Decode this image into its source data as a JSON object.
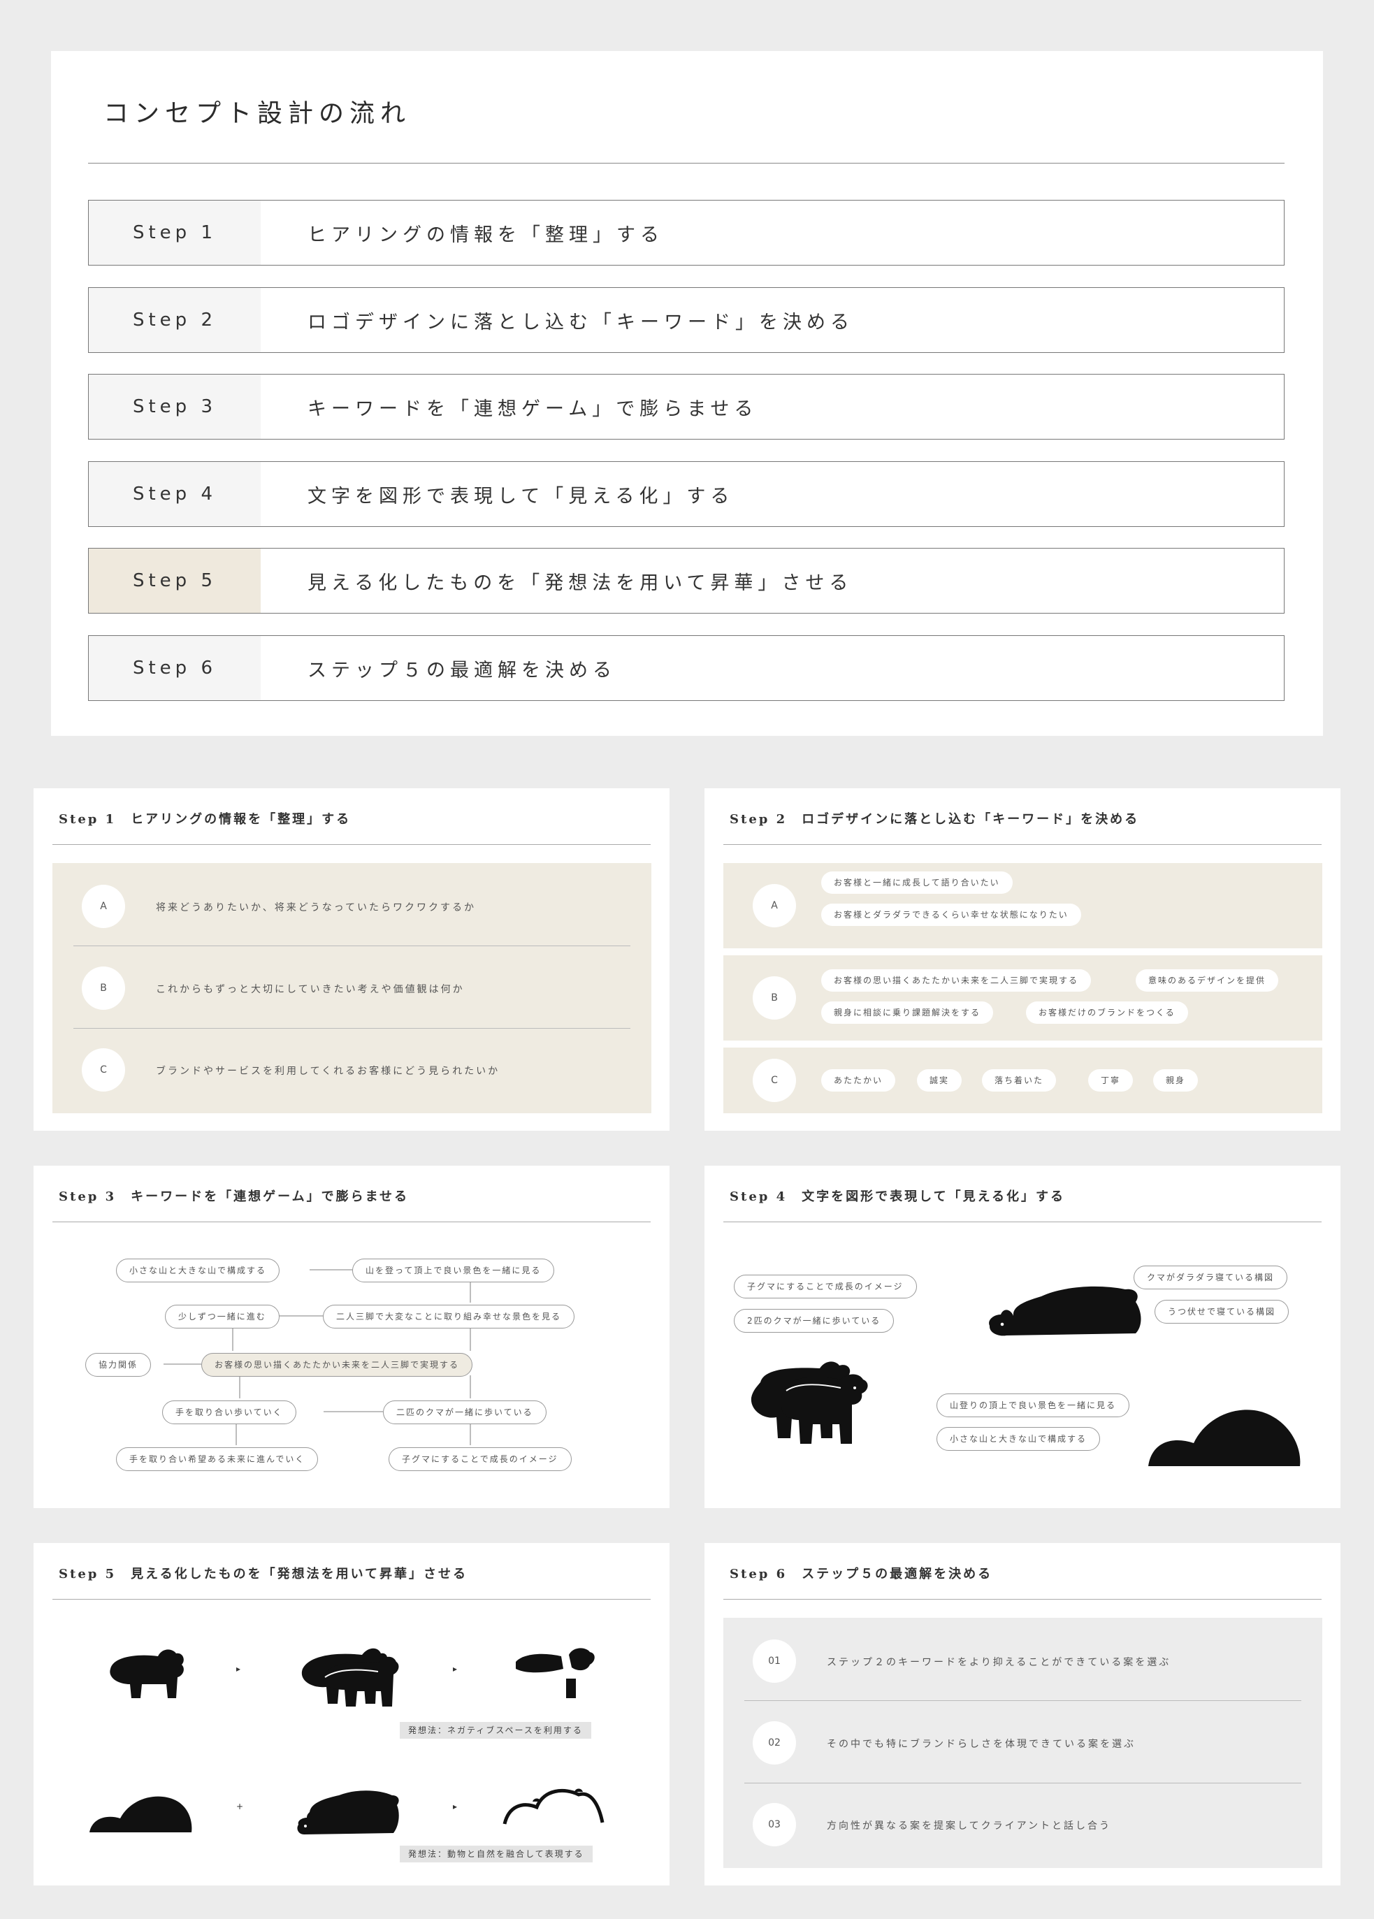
{
  "title": "コンセプト設計の流れ",
  "steps": [
    {
      "label": "Step 1",
      "text": "ヒアリングの情報を「整理」する"
    },
    {
      "label": "Step 2",
      "text": "ロゴデザインに落とし込む「キーワード」を決める"
    },
    {
      "label": "Step 3",
      "text": "キーワードを「連想ゲーム」で膨らませる"
    },
    {
      "label": "Step 4",
      "text": "文字を図形で表現して「見える化」する"
    },
    {
      "label": "Step 5",
      "text": "見える化したものを「発想法を用いて昇華」させる"
    },
    {
      "label": "Step 6",
      "text": "ステップ５の最適解を決める"
    }
  ],
  "card1": {
    "title": "Step 1　ヒアリングの情報を「整理」する",
    "rows": [
      {
        "badge": "A",
        "text": "将来どうありたいか、将来どうなっていたらワクワクするか"
      },
      {
        "badge": "B",
        "text": "これからもずっと大切にしていきたい考えや価値観は何か"
      },
      {
        "badge": "C",
        "text": "ブランドやサービスを利用してくれるお客様にどう見られたいか"
      }
    ]
  },
  "card2": {
    "title": "Step 2　ロゴデザインに落とし込む「キーワード」を決める",
    "groups": [
      {
        "badge": "A",
        "keywords": [
          "お客様と一緒に成長して語り合いたい",
          "お客様とダラダラできるくらい幸せな状態になりたい"
        ]
      },
      {
        "badge": "B",
        "keywords": [
          "お客様の思い描くあたたかい未来を二人三脚で実現する",
          "意味のあるデザインを提供",
          "親身に相談に乗り課題解決をする",
          "お客様だけのブランドをつくる"
        ]
      },
      {
        "badge": "C",
        "keywords": [
          "あたたかい",
          "誠実",
          "落ち着いた",
          "丁寧",
          "親身"
        ]
      }
    ]
  },
  "card3": {
    "title": "Step 3　キーワードを「連想ゲーム」で膨らませる",
    "nodes": {
      "n1": "小さな山と大きな山で構成する",
      "n2": "山を登って頂上で良い景色を一緒に見る",
      "n3": "少しずつ一緒に進む",
      "n4": "二人三脚で大変なことに取り組み幸せな景色を見る",
      "n5": "協力関係",
      "center": "お客様の思い描くあたたかい未来を二人三脚で実現する",
      "n6": "手を取り合い歩いていく",
      "n7": "二匹のクマが一緒に歩いている",
      "n8": "手を取り合い希望ある未来に進んでいく",
      "n9": "子グマにすることで成長のイメージ"
    }
  },
  "card4": {
    "title": "Step 4　文字を図形で表現して「見える化」する",
    "labels": {
      "a": "子グマにすることで成長のイメージ",
      "b": "2匹のクマが一緒に歩いている",
      "c": "クマがダラダラ寝ている構図",
      "d": "うつ伏せで寝ている構図",
      "e": "山登りの頂上で良い景色を一緒に見る",
      "f": "小さな山と大きな山で構成する"
    }
  },
  "card5": {
    "title": "Step 5　見える化したものを「発想法を用いて昇華」させる",
    "ops": [
      "+",
      "▸",
      "+",
      "▸"
    ],
    "method1": "発想法：ネガティブスペースを利用する",
    "method2": "発想法：動物と自然を融合して表現する"
  },
  "card6": {
    "title": "Step 6　ステップ５の最適解を決める",
    "rows": [
      {
        "badge": "01",
        "text": "ステップ２のキーワードをより抑えることができている案を選ぶ"
      },
      {
        "badge": "02",
        "text": "その中でも特にブランドらしさを体現できている案を選ぶ"
      },
      {
        "badge": "03",
        "text": "方向性が異なる案を提案してクライアントと話し合う"
      }
    ]
  }
}
